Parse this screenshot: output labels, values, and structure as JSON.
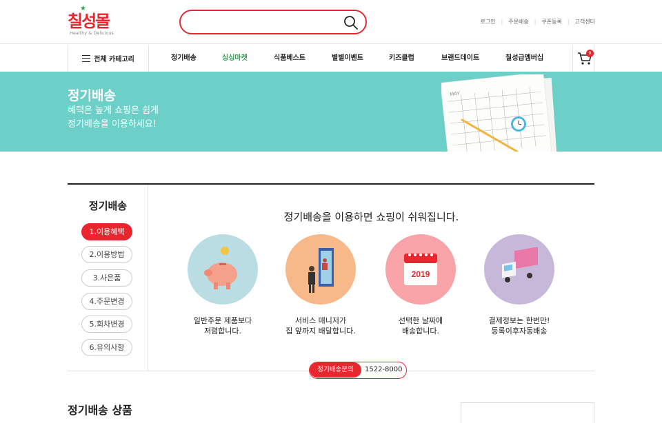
{
  "header": {
    "logo_text": "칠성몰",
    "logo_tagline": "Healthy & Delicious",
    "search": {
      "placeholder": "",
      "value": ""
    },
    "util_links": [
      "로그인",
      "주문배송",
      "쿠폰등록",
      "고객센터"
    ]
  },
  "nav": {
    "all_category": "전체 카테고리",
    "items": [
      {
        "label": "정기배송",
        "active": false
      },
      {
        "label": "싱싱마켓",
        "active": true
      },
      {
        "label": "식품베스트",
        "active": false
      },
      {
        "label": "별별이벤트",
        "active": false
      },
      {
        "label": "키즈클럽",
        "active": false
      },
      {
        "label": "브랜드데이트",
        "active": false
      },
      {
        "label": "칠성급멤버십",
        "active": false
      }
    ],
    "cart_count": "0"
  },
  "banner": {
    "title": "정기배송",
    "line1": "혜택은 높게 쇼핑은 쉽게",
    "line2": "정기배송을 이용하세요!",
    "calendar_month": "MAY"
  },
  "sidebar": {
    "title": "정기배송",
    "items": [
      {
        "label": "1.이용혜택",
        "active": true
      },
      {
        "label": "2.이용방법",
        "active": false
      },
      {
        "label": "3.사은품",
        "active": false
      },
      {
        "label": "4.주문변경",
        "active": false
      },
      {
        "label": "5.회차변경",
        "active": false
      },
      {
        "label": "6.유의사항",
        "active": false
      }
    ]
  },
  "main": {
    "title": "정기배송을 이용하면 쇼핑이 쉬워집니다.",
    "features": [
      {
        "icon": "piggy-bank-icon",
        "line1": "일반주문 제품보다",
        "line2": "저렴합니다.",
        "color": "#b9dde3"
      },
      {
        "icon": "delivery-person-icon",
        "line1": "서비스 매니저가",
        "line2": "집 앞까지 배달합니다.",
        "color": "#f7b88a"
      },
      {
        "icon": "calendar-icon",
        "line1": "선택한 날짜에",
        "line2": "배송합니다.",
        "calendar_year": "2019",
        "color": "#f7a3a8"
      },
      {
        "icon": "delivery-truck-icon",
        "line1": "결제정보는 한번만!",
        "line2": "등록이후자동배송",
        "color": "#c7b8da"
      }
    ],
    "contact": {
      "label": "정기배송문의",
      "phone": "1522-8000"
    }
  },
  "products": {
    "title": "정기배송 상품"
  },
  "colors": {
    "accent": "#e8262f",
    "banner_bg": "#6dd0c8",
    "active_nav": "#2aa44f"
  }
}
